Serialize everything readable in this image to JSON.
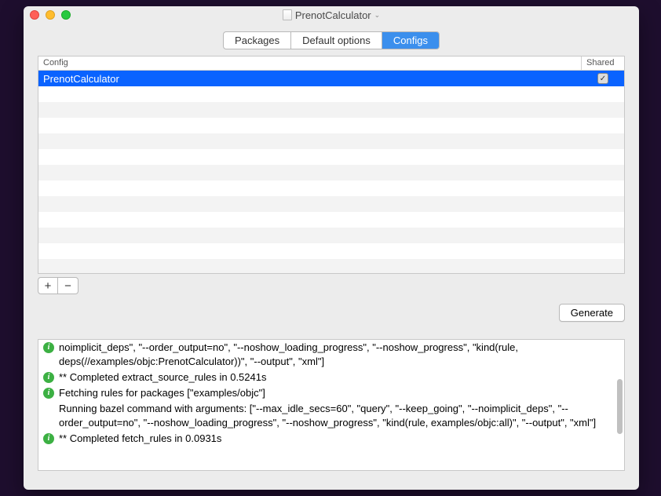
{
  "window": {
    "title": "PrenotCalculator"
  },
  "tabs": {
    "packages": "Packages",
    "defaults": "Default options",
    "configs": "Configs"
  },
  "table": {
    "header_config": "Config",
    "header_shared": "Shared",
    "rows": [
      {
        "name": "PrenotCalculator",
        "shared": true
      }
    ]
  },
  "buttons": {
    "add": "+",
    "remove": "−",
    "generate": "Generate"
  },
  "log": [
    {
      "icon": true,
      "text": "noimplicit_deps\", \"--order_output=no\", \"--noshow_loading_progress\", \"--noshow_progress\", \"kind(rule, deps(//examples/objc:PrenotCalculator))\", \"--output\", \"xml\"]"
    },
    {
      "icon": true,
      "text": "** Completed extract_source_rules in 0.5241s"
    },
    {
      "icon": true,
      "text": "Fetching rules for packages [\"examples/objc\"]"
    },
    {
      "icon": false,
      "text": "Running bazel command with arguments: [\"--max_idle_secs=60\", \"query\", \"--keep_going\", \"--noimplicit_deps\", \"--order_output=no\", \"--noshow_loading_progress\", \"--noshow_progress\", \"kind(rule, examples/objc:all)\", \"--output\", \"xml\"]"
    },
    {
      "icon": true,
      "text": "** Completed fetch_rules in 0.0931s"
    }
  ]
}
